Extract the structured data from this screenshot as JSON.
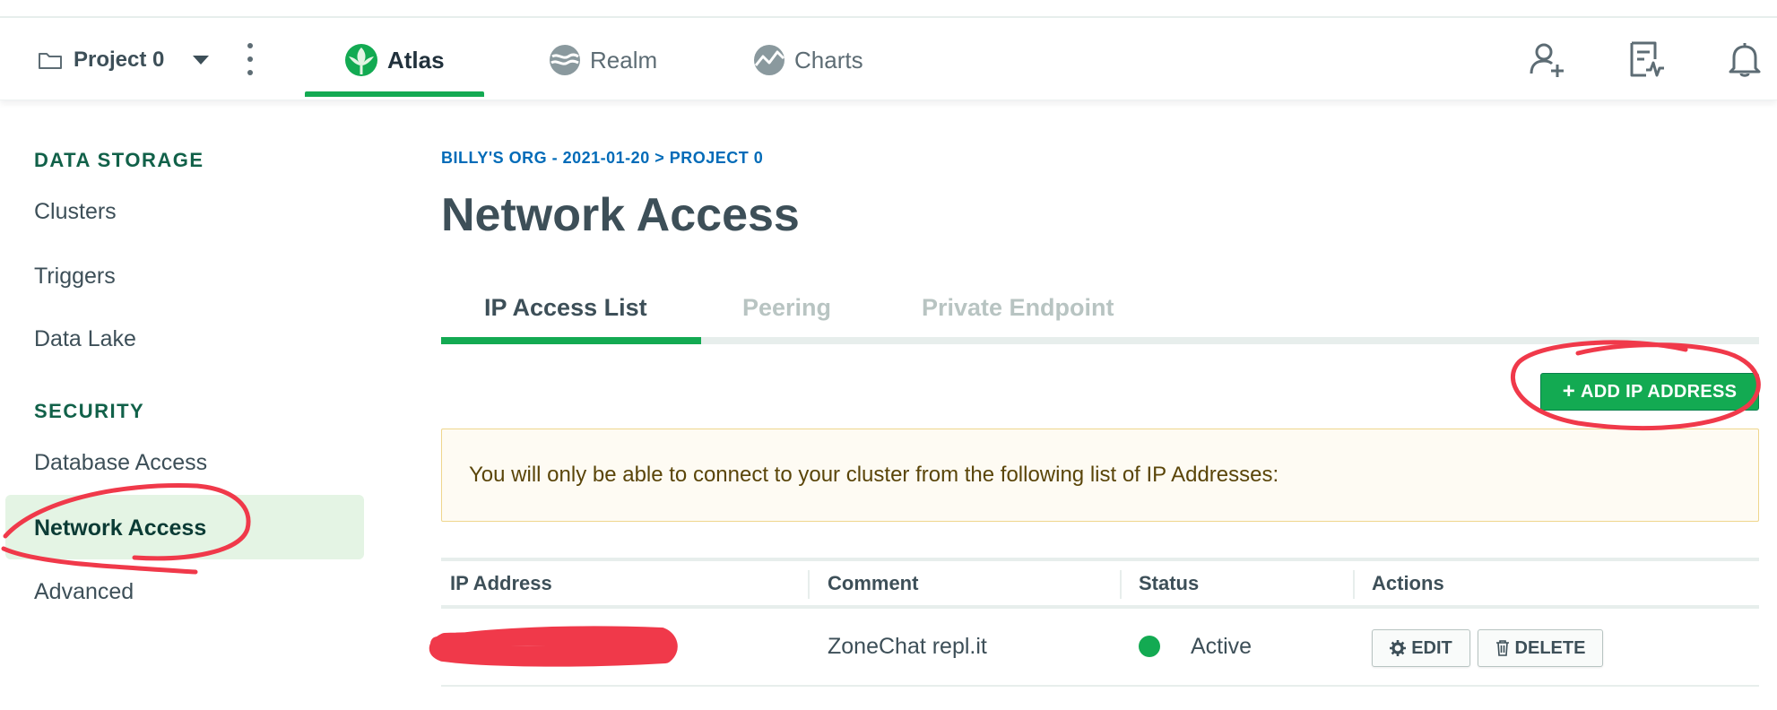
{
  "header": {
    "project_name": "Project 0",
    "nav": [
      {
        "label": "Atlas",
        "active": true
      },
      {
        "label": "Realm",
        "active": false
      },
      {
        "label": "Charts",
        "active": false
      }
    ],
    "icons": [
      "folder-icon",
      "chevron-down-icon",
      "kebab-menu-icon",
      "atlas-leaf-icon",
      "realm-icon",
      "charts-icon",
      "invite-user-icon",
      "activity-feed-icon",
      "bell-icon"
    ]
  },
  "sidebar": {
    "sections": [
      {
        "heading": "DATA STORAGE",
        "items": [
          "Clusters",
          "Triggers",
          "Data Lake"
        ]
      },
      {
        "heading": "SECURITY",
        "items": [
          "Database Access",
          "Network Access",
          "Advanced"
        ]
      }
    ],
    "active_item": "Network Access"
  },
  "main": {
    "breadcrumb": "BILLY'S ORG - 2021-01-20 > PROJECT 0",
    "title": "Network Access",
    "tabs": [
      {
        "label": "IP Access List",
        "active": true
      },
      {
        "label": "Peering",
        "active": false
      },
      {
        "label": "Private Endpoint",
        "active": false
      }
    ],
    "add_button": "ADD IP ADDRESS",
    "banner": "You will only be able to connect to your cluster from the following list of IP Addresses:",
    "table": {
      "columns": [
        "IP Address",
        "Comment",
        "Status",
        "Actions"
      ],
      "rows": [
        {
          "ip": "",
          "comment": "ZoneChat repl.it",
          "status": "Active",
          "actions": [
            "EDIT",
            "DELETE"
          ]
        }
      ]
    }
  },
  "colors": {
    "accent_green": "#13aa52",
    "sidebar_heading": "#116149",
    "breadcrumb_blue": "#016bb8",
    "annotation_red": "#f0394a",
    "banner_bg": "#fefbf3"
  }
}
